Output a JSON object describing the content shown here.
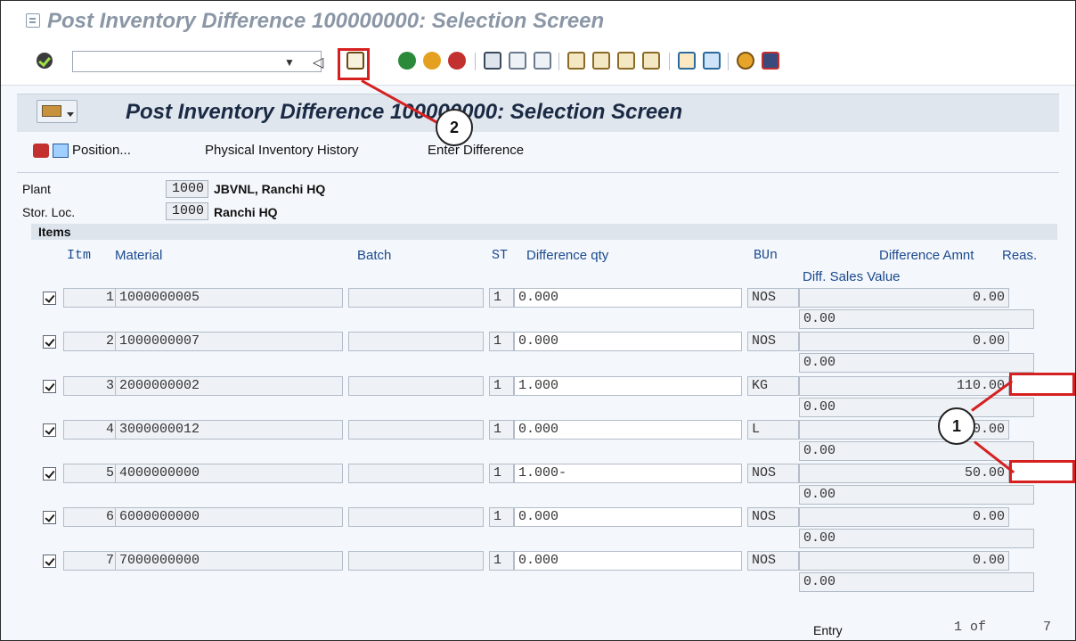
{
  "window_title": "Post Inventory Difference 100000000: Selection Screen",
  "screen_title": "Post Inventory Difference 100000000: Selection Screen",
  "toolbar": {
    "command_value": ""
  },
  "app_toolbar": {
    "position_label": "Position...",
    "history_label": "Physical Inventory History",
    "difference_label": "Enter Difference"
  },
  "header": {
    "plant_label": "Plant",
    "plant_code": "1000",
    "plant_desc": "JBVNL, Ranchi HQ",
    "sloc_label": "Stor. Loc.",
    "sloc_code": "1000",
    "sloc_desc": "Ranchi HQ"
  },
  "items": {
    "section_label": "Items",
    "columns": {
      "item": "Itm",
      "material": "Material",
      "batch": "Batch",
      "stock_type": "ST",
      "diff_qty": "Difference qty",
      "unit": "BUn",
      "diff_amount": "Difference Amnt",
      "reason": "Reas.",
      "sales_value": "Diff. Sales Value"
    },
    "rows": [
      {
        "item": "1",
        "material": "1000000005",
        "batch": "",
        "st": "1",
        "qty": "0.000",
        "unit": "NOS",
        "amount": "0.00",
        "sales": "0.00"
      },
      {
        "item": "2",
        "material": "1000000007",
        "batch": "",
        "st": "1",
        "qty": "0.000",
        "unit": "NOS",
        "amount": "0.00",
        "sales": "0.00"
      },
      {
        "item": "3",
        "material": "2000000002",
        "batch": "",
        "st": "1",
        "qty": "1.000",
        "unit": "KG",
        "amount": "110.00",
        "sales": "0.00"
      },
      {
        "item": "4",
        "material": "3000000012",
        "batch": "",
        "st": "1",
        "qty": "0.000",
        "unit": "L",
        "amount": "0.00",
        "sales": "0.00"
      },
      {
        "item": "5",
        "material": "4000000000",
        "batch": "",
        "st": "1",
        "qty": "1.000-",
        "unit": "NOS",
        "amount": "50.00",
        "sales": "0.00"
      },
      {
        "item": "6",
        "material": "6000000000",
        "batch": "",
        "st": "1",
        "qty": "0.000",
        "unit": "NOS",
        "amount": "0.00",
        "sales": "0.00"
      },
      {
        "item": "7",
        "material": "7000000000",
        "batch": "",
        "st": "1",
        "qty": "0.000",
        "unit": "NOS",
        "amount": "0.00",
        "sales": "0.00"
      }
    ]
  },
  "entry": {
    "label": "Entry",
    "current": "1 of",
    "total": "7"
  },
  "callouts": {
    "one": "1",
    "two": "2"
  },
  "colors": {
    "callout_red": "#d62020",
    "title_blue": "#1b2a44",
    "column_blue": "#1b4a90"
  },
  "icons": {
    "toolbar": [
      "enter-icon",
      "back-icon",
      "exit-icon",
      "cancel-icon",
      "print-icon",
      "find-icon",
      "find-next-icon",
      "first-page-icon",
      "previous-page-icon",
      "next-page-icon",
      "last-page-icon",
      "create-session-icon",
      "shortcut-icon",
      "help-icon",
      "layout-icon"
    ]
  }
}
